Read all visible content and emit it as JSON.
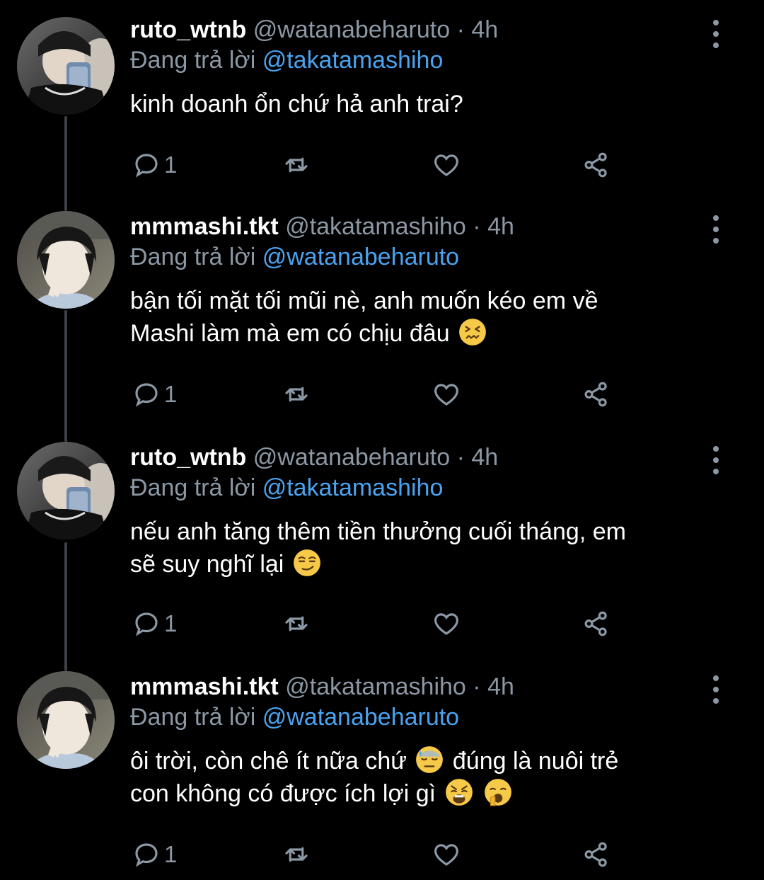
{
  "tweets": [
    {
      "display_name": "ruto_wtnb",
      "handle": "@watanabeharuto",
      "separator": "·",
      "time": "4h",
      "reply_prefix": "Đang trả lời",
      "reply_to": "@takatamashiho",
      "text_lines": [
        "kinh doanh ổn chứ hả anh trai?"
      ],
      "reply_count": "1",
      "avatar": "avatar-ruto"
    },
    {
      "display_name": "mmmashi.tkt",
      "handle": "@takatamashiho",
      "separator": "·",
      "time": "4h",
      "reply_prefix": "Đang trả lời",
      "reply_to": "@watanabeharuto",
      "text_lines": [
        "bận tối mặt tối mũi nè, anh muốn kéo em về",
        "Mashi làm mà em có chịu đâu"
      ],
      "emojis": [
        "confounded-face-emoji"
      ],
      "reply_count": "1",
      "avatar": "avatar-mashi"
    },
    {
      "display_name": "ruto_wtnb",
      "handle": "@watanabeharuto",
      "separator": "·",
      "time": "4h",
      "reply_prefix": "Đang trả lời",
      "reply_to": "@takatamashiho",
      "text_lines": [
        "nếu anh tăng thêm tiền thưởng cuối tháng, em",
        "sẽ suy nghĩ lại"
      ],
      "emojis": [
        "smirking-face-emoji"
      ],
      "reply_count": "1",
      "avatar": "avatar-ruto"
    },
    {
      "display_name": "mmmashi.tkt",
      "handle": "@takatamashiho",
      "separator": "·",
      "time": "4h",
      "reply_prefix": "Đang trả lời",
      "reply_to": "@watanabeharuto",
      "text_parts": [
        "ôi trời, còn chê ít nữa chứ",
        "đúng là nuôi trẻ",
        "con không có được ích lợi gì"
      ],
      "emojis": [
        "downcast-sweat-face-emoji",
        "weary-face-emoji",
        "yawning-face-emoji"
      ],
      "reply_count": "1",
      "avatar": "avatar-mashi"
    }
  ],
  "icons": {
    "reply": "reply-icon",
    "retweet": "retweet-icon",
    "like": "heart-icon",
    "share": "share-icon",
    "more": "more-vertical-icon"
  },
  "colors": {
    "background": "#000000",
    "text": "#ffffff",
    "secondary": "#8b98a5",
    "mention": "#4aa3f0",
    "thread_line": "#3d4147"
  }
}
